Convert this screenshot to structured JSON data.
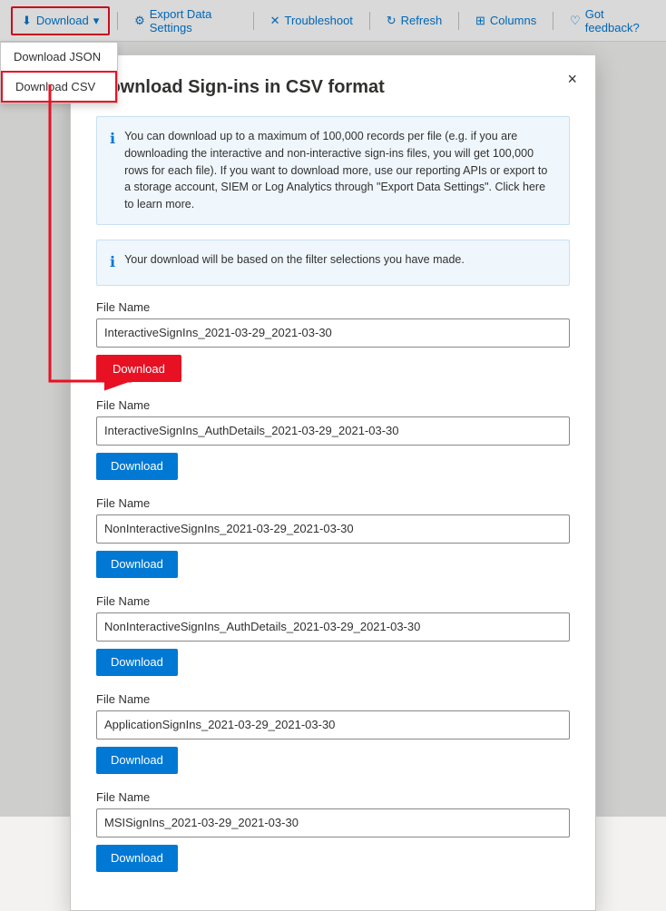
{
  "toolbar": {
    "download_label": "Download",
    "chevron": "▾",
    "export_label": "Export Data Settings",
    "troubleshoot_label": "Troubleshoot",
    "refresh_label": "Refresh",
    "columns_label": "Columns",
    "feedback_label": "Got feedback?"
  },
  "dropdown": {
    "json_label": "Download JSON",
    "csv_label": "Download CSV"
  },
  "modal": {
    "title": "Download Sign-ins in CSV format",
    "close_label": "×",
    "info1": "You can download up to a maximum of 100,000 records per file (e.g. if you are downloading the interactive and non-interactive sign-ins files, you will get 100,000 rows for each file). If you want to download more, use our reporting APIs or export to a storage account, SIEM or Log Analytics through \"Export Data Settings\". Click here to learn more.",
    "info2": "Your download will be based on the filter selections you have made.",
    "files": [
      {
        "label": "File Name",
        "value": "InteractiveSignIns_2021-03-29_2021-03-30",
        "button": "Download",
        "first": true
      },
      {
        "label": "File Name",
        "value": "InteractiveSignIns_AuthDetails_2021-03-29_2021-03-30",
        "button": "Download",
        "first": false
      },
      {
        "label": "File Name",
        "value": "NonInteractiveSignIns_2021-03-29_2021-03-30",
        "button": "Download",
        "first": false
      },
      {
        "label": "File Name",
        "value": "NonInteractiveSignIns_AuthDetails_2021-03-29_2021-03-30",
        "button": "Download",
        "first": false
      },
      {
        "label": "File Name",
        "value": "ApplicationSignIns_2021-03-29_2021-03-30",
        "button": "Download",
        "first": false
      },
      {
        "label": "File Name",
        "value": "MSISignIns_2021-03-29_2021-03-30",
        "button": "Download",
        "first": false
      }
    ]
  }
}
